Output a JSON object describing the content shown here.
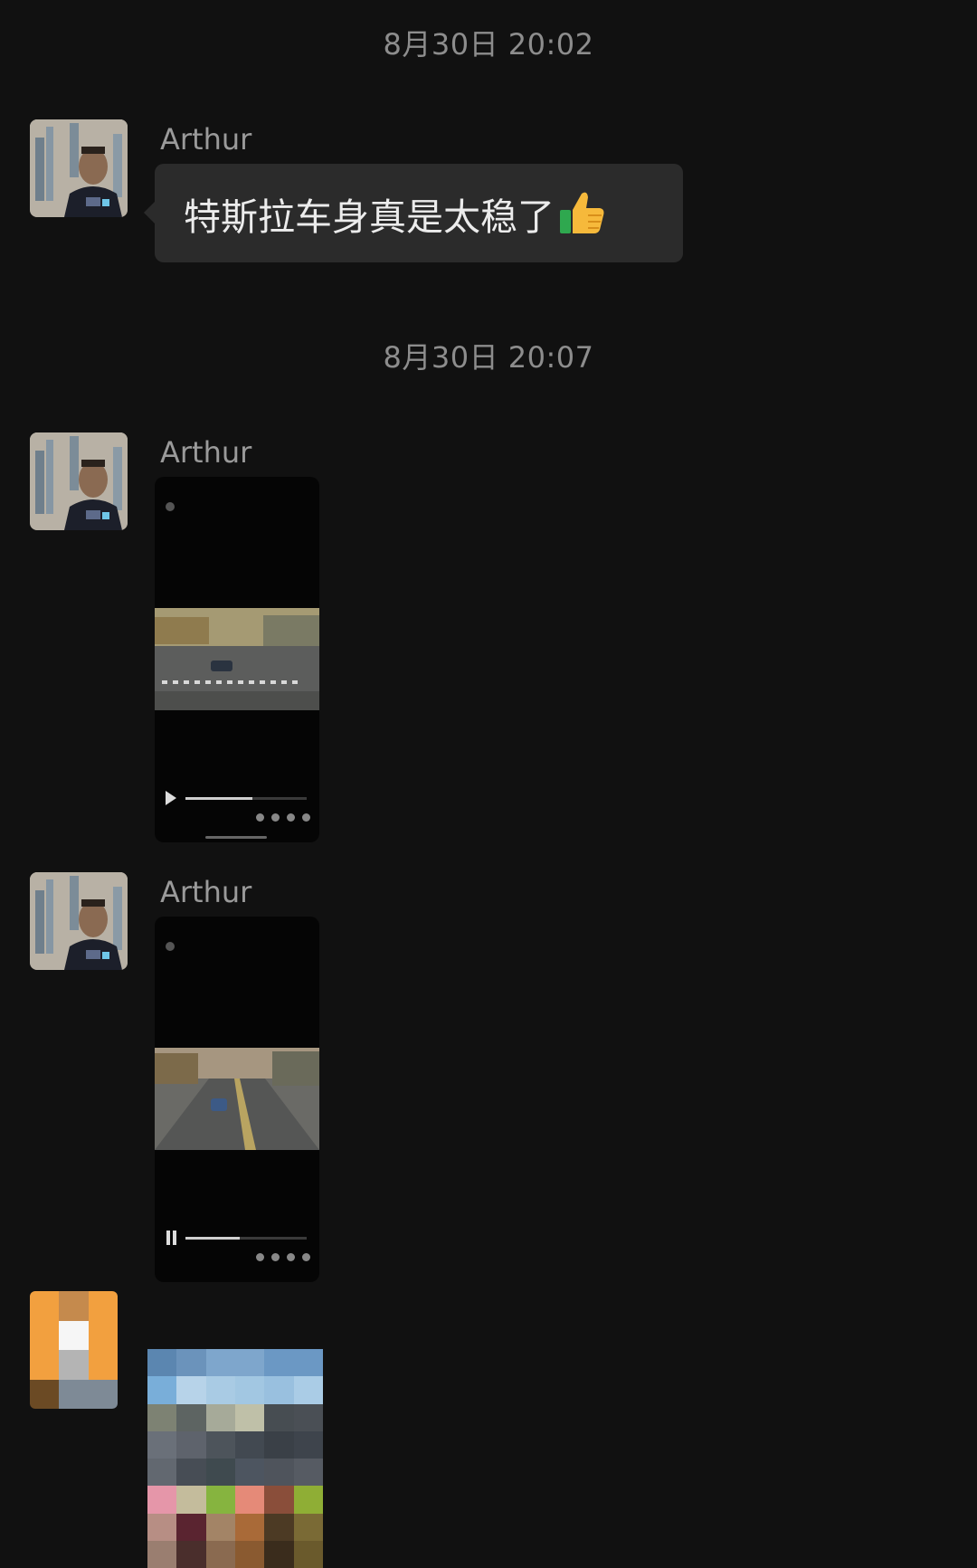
{
  "timestamps": [
    "8月30日 20:02",
    "8月30日 20:07"
  ],
  "messages": [
    {
      "sender": "Arthur",
      "type": "text",
      "text": "特斯拉车身真是太稳了"
    },
    {
      "sender": "Arthur",
      "type": "video",
      "playback_progress": 0.55
    },
    {
      "sender": "Arthur",
      "type": "video",
      "playback_progress": 0.45
    }
  ],
  "emoji": "thumbs-up-icon",
  "colors": {
    "background": "#111111",
    "bubble": "#2b2b2b",
    "timestamp": "#8d8d8d",
    "sender": "#9a9a9a"
  },
  "mosaic_avatar_colors": [
    "#f2a03f",
    "#c58a4d",
    "#f2a03f",
    "#f2a03f",
    "#f6f6f6",
    "#f2a03f",
    "#f2a03f",
    "#b4b4b4",
    "#f2a03f",
    "#6b4a24",
    "#7e8a96",
    "#7e8a96"
  ],
  "mosaic_image_colors": [
    "#5b86b0",
    "#6b93bb",
    "#7ea6cc",
    "#7ea6cc",
    "#6b98c4",
    "#6b98c4",
    "#79aed9",
    "#b7d3e9",
    "#a9cbe4",
    "#a2c7e2",
    "#99c0df",
    "#aacce6",
    "#7d8273",
    "#5d6462",
    "#a6aa99",
    "#bfc0a8",
    "#474d52",
    "#4a4f55",
    "#6a7079",
    "#5e636c",
    "#4d545b",
    "#424951",
    "#3a4047",
    "#3e444c",
    "#626870",
    "#474d55",
    "#3f4a4f",
    "#4d5560",
    "#4f545c",
    "#565b63",
    "#e596a9",
    "#c4bc9c",
    "#86b43f",
    "#e58a78",
    "#8a4e3a",
    "#8fae35",
    "#b78e84",
    "#5a2430",
    "#a38466",
    "#a96a38",
    "#4c3a24",
    "#7a6a35",
    "#9a7e70",
    "#4a2e2c",
    "#8a6a50",
    "#8a5a30",
    "#3a2c1c",
    "#6a5a2c"
  ]
}
